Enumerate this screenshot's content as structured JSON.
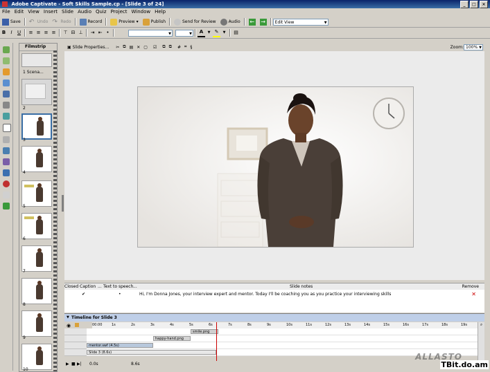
{
  "window": {
    "title": "Adobe Captivate - Soft Skills Sample.cp - [Slide 3 of 24]"
  },
  "menu": [
    "File",
    "Edit",
    "View",
    "Insert",
    "Slide",
    "Audio",
    "Quiz",
    "Project",
    "Window",
    "Help"
  ],
  "toolbar": {
    "save": "Save",
    "undo": "Undo",
    "redo": "Redo",
    "record": "Record",
    "preview": "Preview",
    "publish": "Publish",
    "send_for_review": "Send for Review",
    "audio": "Audio",
    "view_mode": "Edit View"
  },
  "format_bar": {
    "bold": "B",
    "italic": "I",
    "underline": "U",
    "text_color": "A"
  },
  "filmstrip": {
    "title": "Filmstrip",
    "slides": [
      {
        "label": "1 Scena..."
      },
      {
        "label": "2"
      },
      {
        "label": "3"
      },
      {
        "label": "4"
      },
      {
        "label": "5"
      },
      {
        "label": "6"
      },
      {
        "label": "7"
      },
      {
        "label": "8"
      },
      {
        "label": "9"
      },
      {
        "label": "10"
      }
    ]
  },
  "stage": {
    "slide_properties": "Slide Properties...",
    "zoom_label": "Zoom:",
    "zoom_value": "100%"
  },
  "notes": {
    "col_closed_caption": "Closed Caption",
    "col_text_to_speech": "Text to speech",
    "col_slide_notes": "Slide notes",
    "col_remove": "Remove",
    "note_text": "Hi, I'm Donna Jones, your interview expert and mentor. Today I'll be coaching you as you practice your interviewing skills"
  },
  "timeline": {
    "title": "Timeline for Slide 3",
    "ruler_ticks": [
      "00:00",
      "1s",
      "2s",
      "3s",
      "4s",
      "5s",
      "6s",
      "7s",
      "8s",
      "9s",
      "10s",
      "11s",
      "12s",
      "13s",
      "14s",
      "15s",
      "16s",
      "17s",
      "18s",
      "19s"
    ],
    "layers": [
      {
        "label": "smile.png"
      },
      {
        "label": "happy-hand.png"
      },
      {
        "label": "mentor.swf (4.5s)"
      },
      {
        "label": "Slide 3 (8.6s)"
      }
    ],
    "start_time": "0.0s",
    "end_time": "8.6s"
  },
  "watermarks": {
    "brand": "ALLASTO",
    "site": "TBit.do.am"
  }
}
